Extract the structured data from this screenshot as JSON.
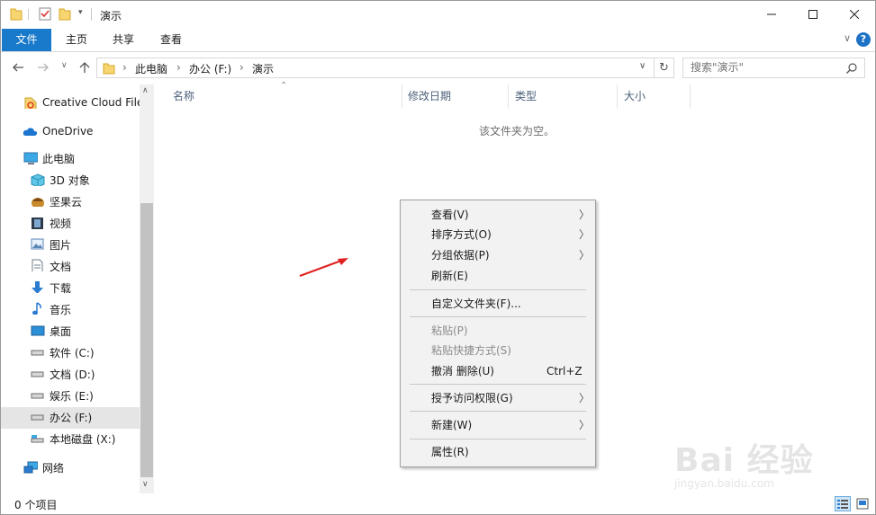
{
  "window": {
    "title": "演示"
  },
  "ribbon": {
    "tabs": [
      {
        "label": "文件"
      },
      {
        "label": "主页"
      },
      {
        "label": "共享"
      },
      {
        "label": "查看"
      }
    ],
    "help_label": "?"
  },
  "address": {
    "segments": [
      {
        "label": "此电脑"
      },
      {
        "label": "办公 (F:)"
      },
      {
        "label": "演示"
      }
    ],
    "separator": "›"
  },
  "search": {
    "placeholder": "搜索\"演示\""
  },
  "navigation": {
    "items": [
      {
        "label": "Creative Cloud File",
        "icon": "creative-cloud-icon"
      },
      {
        "label": "OneDrive",
        "icon": "cloud-icon"
      },
      {
        "label": "此电脑",
        "icon": "computer-icon"
      },
      {
        "label": "3D 对象",
        "icon": "cube-icon"
      },
      {
        "label": "坚果云",
        "icon": "nut-icon"
      },
      {
        "label": "视频",
        "icon": "film-icon"
      },
      {
        "label": "图片",
        "icon": "picture-icon"
      },
      {
        "label": "文档",
        "icon": "document-icon"
      },
      {
        "label": "下载",
        "icon": "download-icon"
      },
      {
        "label": "音乐",
        "icon": "music-icon"
      },
      {
        "label": "桌面",
        "icon": "desktop-icon"
      },
      {
        "label": "软件 (C:)",
        "icon": "drive-icon"
      },
      {
        "label": "文档 (D:)",
        "icon": "drive-icon"
      },
      {
        "label": "娱乐 (E:)",
        "icon": "drive-icon"
      },
      {
        "label": "办公 (F:)",
        "icon": "drive-icon",
        "selected": true
      },
      {
        "label": "本地磁盘 (X:)",
        "icon": "system-drive-icon"
      },
      {
        "label": "网络",
        "icon": "network-icon"
      }
    ]
  },
  "columns": [
    {
      "label": "名称"
    },
    {
      "label": "修改日期"
    },
    {
      "label": "类型"
    },
    {
      "label": "大小"
    }
  ],
  "content": {
    "empty_message": "该文件夹为空。"
  },
  "status": {
    "item_count": "0 个项目"
  },
  "context_menu": {
    "items": [
      {
        "label": "查看(V)",
        "submenu": true
      },
      {
        "label": "排序方式(O)",
        "submenu": true
      },
      {
        "label": "分组依据(P)",
        "submenu": true
      },
      {
        "label": "刷新(E)"
      },
      {
        "label": "自定义文件夹(F)..."
      },
      {
        "label": "粘贴(P)",
        "disabled": true
      },
      {
        "label": "粘贴快捷方式(S)",
        "disabled": true
      },
      {
        "label": "撤消 删除(U)",
        "shortcut": "Ctrl+Z"
      },
      {
        "label": "授予访问权限(G)",
        "submenu": true
      },
      {
        "label": "新建(W)",
        "submenu": true
      },
      {
        "label": "属性(R)"
      }
    ]
  },
  "watermark": {
    "brand": "Bai 经验",
    "url": "jingyan.baidu.com"
  },
  "colors": {
    "accent": "#1979ca",
    "annotation_arrow": "#e02020",
    "folder": "#f2c94c"
  }
}
